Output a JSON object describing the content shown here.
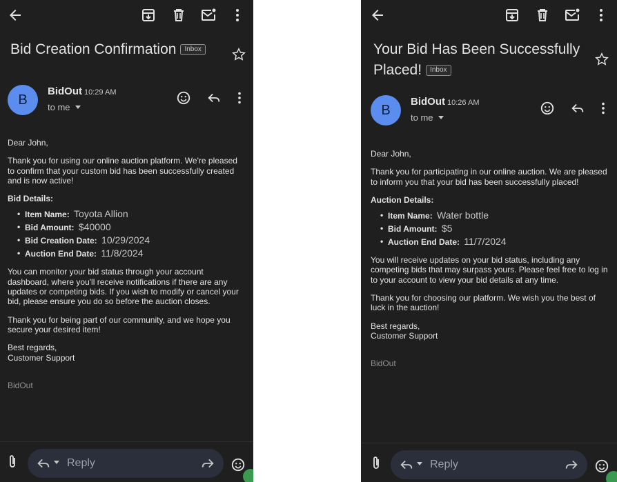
{
  "left": {
    "subject": "Bid Creation Confirmation",
    "inbox_label": "Inbox",
    "avatar_letter": "B",
    "sender": "BidOut",
    "time": "10:29 AM",
    "to": "to me",
    "greeting": "Dear John,",
    "intro": "Thank you for using our online auction platform. We're pleased to confirm that your custom bid has been successfully created and is now active!",
    "details_heading": "Bid Details:",
    "details": [
      {
        "label": "Item Name:",
        "value": "Toyota Allion"
      },
      {
        "label": "Bid Amount:",
        "value": "$40000"
      },
      {
        "label": "Bid Creation Date:",
        "value": "10/29/2024"
      },
      {
        "label": "Auction End Date:",
        "value": "11/8/2024"
      }
    ],
    "para2": "You can monitor your bid status through your account dashboard, where you'll receive notifications if there are any updates or competing bids. If you wish to modify or cancel your bid, please ensure you do so before the auction closes.",
    "para3": "Thank you for being part of our community, and we hope you secure your desired item!",
    "signoff1": "Best regards,",
    "signoff2": "Customer Support",
    "brand_footer": "BidOut",
    "reply_label": "Reply"
  },
  "right": {
    "subject_line1": "Your Bid Has Been Successfully",
    "subject_line2": "Placed!",
    "inbox_label": "Inbox",
    "avatar_letter": "B",
    "sender": "BidOut",
    "time": "10:26 AM",
    "to": "to me",
    "greeting": "Dear John,",
    "intro": "Thank you for participating in our online auction. We are pleased to inform you that your bid has been successfully placed!",
    "details_heading": "Auction Details:",
    "details": [
      {
        "label": "Item Name:",
        "value": "Water bottle"
      },
      {
        "label": "Bid Amount:",
        "value": "$5"
      },
      {
        "label": "Auction End Date:",
        "value": "11/7/2024"
      }
    ],
    "para2": "You will receive updates on your bid status, including any competing bids that may surpass yours. Please feel free to log in to your account to view your bid details at any time.",
    "para3": "Thank you for choosing our platform. We wish you the best of luck in the auction!",
    "signoff1": "Best regards,",
    "signoff2": "Customer Support",
    "brand_footer": "BidOut",
    "reply_label": "Reply"
  },
  "icons": {
    "back": "arrow-back-icon",
    "archive": "archive-icon",
    "delete": "trash-icon",
    "mark_unread": "mail-unread-icon",
    "more": "more-vert-icon",
    "star": "star-icon",
    "emoji": "emoji-icon",
    "reply": "reply-icon",
    "forward": "forward-icon",
    "attach": "attach-icon"
  },
  "colors": {
    "background": "#1f1f1f",
    "avatar": "#5b8def",
    "text": "#e3e3e3",
    "reply_pill": "#2a2f3b"
  }
}
